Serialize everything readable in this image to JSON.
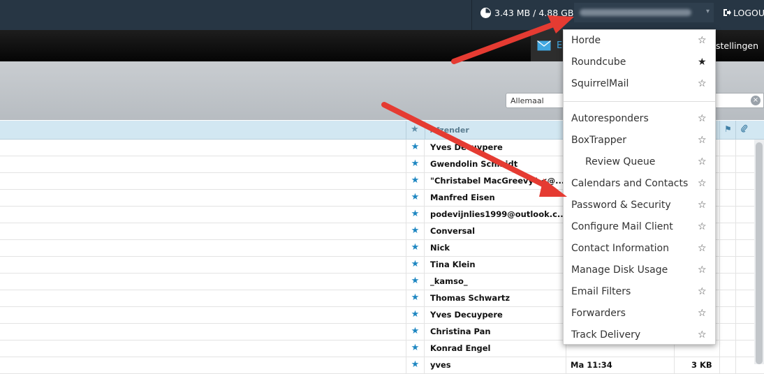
{
  "topbar": {
    "disk_usage": "3.43 MB / 4.88 GB",
    "logout_label": "LOGOUT"
  },
  "nav": {
    "email_tab_label": "E",
    "settings_label": "stellingen"
  },
  "toolbar": {
    "filter_value": "Allemaal",
    "clear_symbol": "×"
  },
  "table": {
    "sender_header": "Afzender",
    "rows": [
      {
        "sender": "Yves Decuypere",
        "date": "",
        "size": ""
      },
      {
        "sender": "Gwendolin Schmidt",
        "date": "",
        "size": ""
      },
      {
        "sender": "\"Christabel MacGreevy\" <@...",
        "date": "",
        "size": ""
      },
      {
        "sender": "Manfred Eisen",
        "date": "",
        "size": ""
      },
      {
        "sender": "podevijnlies1999@outlook.c...",
        "date": "",
        "size": ""
      },
      {
        "sender": "Conversal",
        "date": "",
        "size": ""
      },
      {
        "sender": "Nick",
        "date": "",
        "size": ""
      },
      {
        "sender": "Tina Klein",
        "date": "",
        "size": ""
      },
      {
        "sender": "_kamso_",
        "date": "",
        "size": ""
      },
      {
        "sender": "Thomas Schwartz",
        "date": "",
        "size": ""
      },
      {
        "sender": "Yves Decuypere",
        "date": "",
        "size": ""
      },
      {
        "sender": "Christina Pan",
        "date": "",
        "size": ""
      },
      {
        "sender": "Konrad Engel",
        "date": "",
        "size": ""
      },
      {
        "sender": "yves",
        "date": "Ma 11:34",
        "size": "3 KB"
      }
    ]
  },
  "menu": {
    "items": [
      {
        "label": "Horde",
        "starred": false
      },
      {
        "label": "Roundcube",
        "starred": true
      },
      {
        "label": "SquirrelMail",
        "starred": false
      },
      {
        "label": "Autoresponders",
        "starred": false
      },
      {
        "label": "BoxTrapper",
        "starred": false
      },
      {
        "label": "Review Queue",
        "starred": false
      },
      {
        "label": "Calendars and Contacts",
        "starred": false
      },
      {
        "label": "Password & Security",
        "starred": false
      },
      {
        "label": "Configure Mail Client",
        "starred": false
      },
      {
        "label": "Contact Information",
        "starred": false
      },
      {
        "label": "Manage Disk Usage",
        "starred": false
      },
      {
        "label": "Email Filters",
        "starred": false
      },
      {
        "label": "Forwarders",
        "starred": false
      },
      {
        "label": "Track Delivery",
        "starred": false
      }
    ]
  },
  "icons": {
    "star_filled": "★",
    "star_empty": "☆",
    "flag": "⚑",
    "clip": "📎",
    "caret": "▾"
  },
  "colors": {
    "topbar": "#273644",
    "accent_blue": "#1d86c1",
    "header_row": "#d2e7f2",
    "arrow_red": "#e53b32"
  }
}
